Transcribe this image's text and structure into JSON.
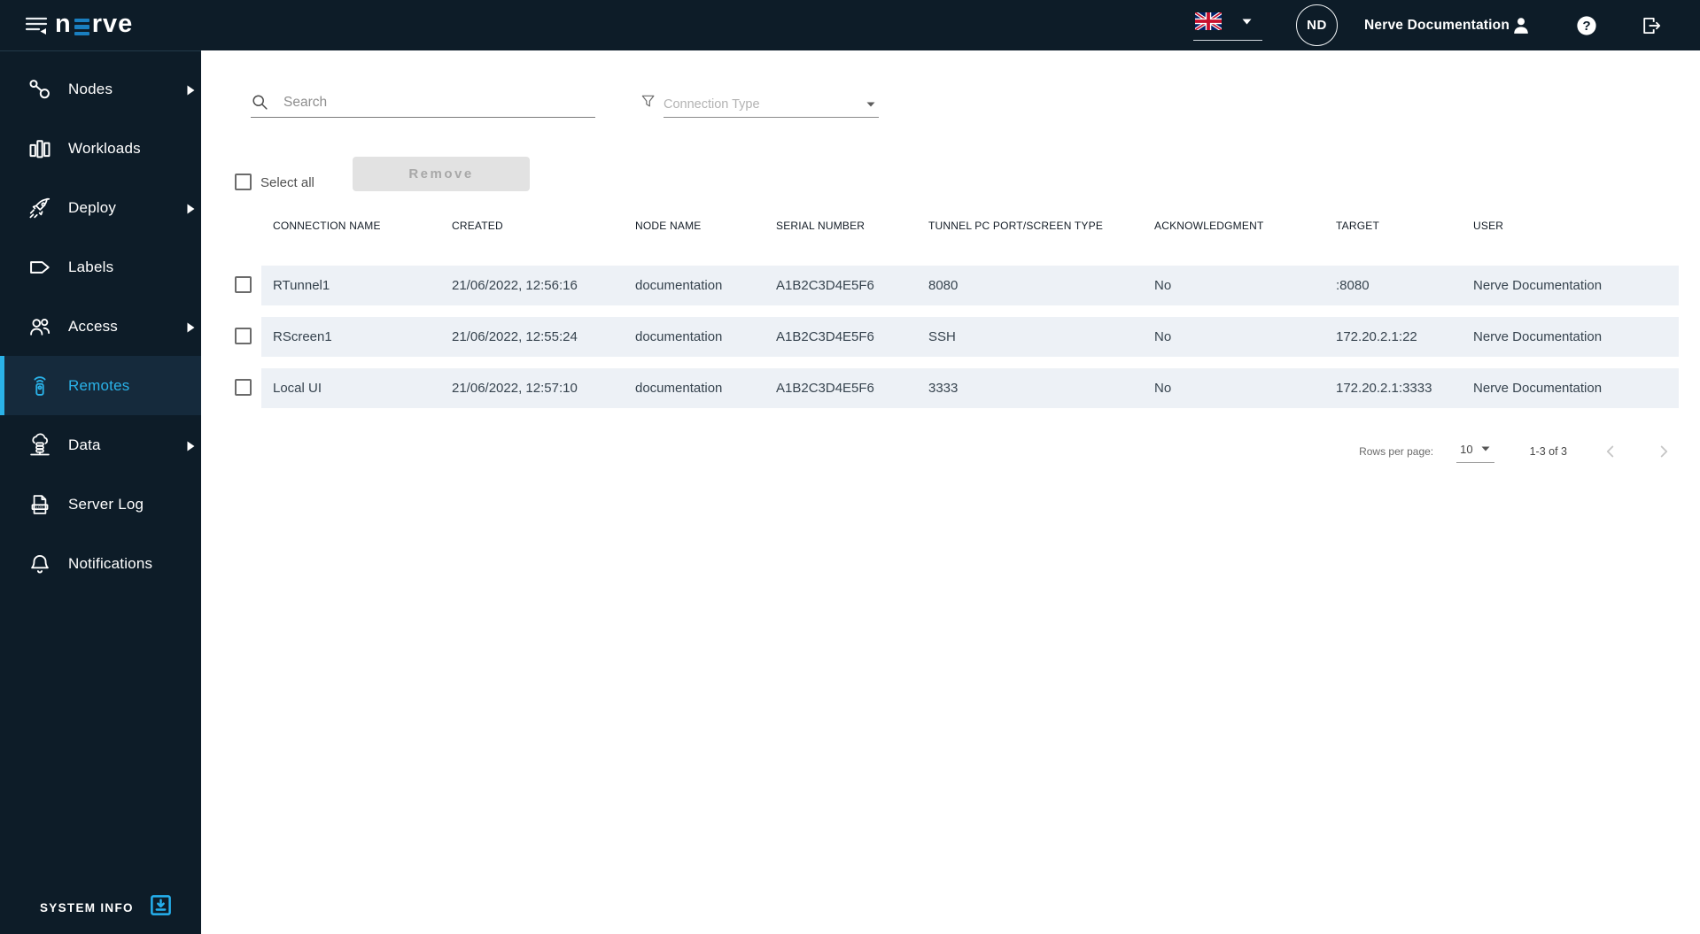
{
  "topbar": {
    "brand_prefix": "n",
    "brand_suffix": "rve",
    "language": {
      "icon": "uk-flag"
    },
    "user": {
      "initials": "ND",
      "name": "Nerve Documentation"
    }
  },
  "sidebar": {
    "items": [
      {
        "label": "Nodes",
        "icon": "nodes-icon",
        "has_submenu": true,
        "selected": false
      },
      {
        "label": "Workloads",
        "icon": "workloads-icon",
        "has_submenu": false,
        "selected": false
      },
      {
        "label": "Deploy",
        "icon": "deploy-icon",
        "has_submenu": true,
        "selected": false
      },
      {
        "label": "Labels",
        "icon": "labels-icon",
        "has_submenu": false,
        "selected": false
      },
      {
        "label": "Access",
        "icon": "access-icon",
        "has_submenu": true,
        "selected": false
      },
      {
        "label": "Remotes",
        "icon": "remotes-icon",
        "has_submenu": false,
        "selected": true
      },
      {
        "label": "Data",
        "icon": "data-icon",
        "has_submenu": true,
        "selected": false
      },
      {
        "label": "Server Log",
        "icon": "server-log-icon",
        "has_submenu": false,
        "selected": false
      },
      {
        "label": "Notifications",
        "icon": "notifications-icon",
        "has_submenu": false,
        "selected": false
      }
    ],
    "footer_label": "SYSTEM INFO"
  },
  "toolbar": {
    "search_placeholder": "Search",
    "filter_placeholder": "Connection Type",
    "select_all_label": "Select all",
    "remove_label": "Remove"
  },
  "table": {
    "columns": [
      "CONNECTION NAME",
      "CREATED",
      "NODE NAME",
      "SERIAL NUMBER",
      "TUNNEL PC PORT/SCREEN TYPE",
      "ACKNOWLEDGMENT",
      "TARGET",
      "USER"
    ],
    "rows": [
      {
        "connection_name": "RTunnel1",
        "created": "21/06/2022, 12:56:16",
        "node_name": "documentation",
        "serial_number": "A1B2C3D4E5F6",
        "tunnel_pc_port_screen_type": "8080",
        "acknowledgment": "No",
        "target": ":8080",
        "user": "Nerve Documentation"
      },
      {
        "connection_name": "RScreen1",
        "created": "21/06/2022, 12:55:24",
        "node_name": "documentation",
        "serial_number": "A1B2C3D4E5F6",
        "tunnel_pc_port_screen_type": "SSH",
        "acknowledgment": "No",
        "target": "172.20.2.1:22",
        "user": "Nerve Documentation"
      },
      {
        "connection_name": "Local UI",
        "created": "21/06/2022, 12:57:10",
        "node_name": "documentation",
        "serial_number": "A1B2C3D4E5F6",
        "tunnel_pc_port_screen_type": "3333",
        "acknowledgment": "No",
        "target": "172.20.2.1:3333",
        "user": "Nerve Documentation"
      }
    ]
  },
  "pagination": {
    "rows_per_page_label": "Rows per page:",
    "rows_per_page_value": "10",
    "range_label": "1-3 of 3"
  },
  "colors": {
    "topbar_bg": "#0d1c28",
    "accent_blue": "#2ab2e8",
    "logo_bar_blue": "#1a7fc0",
    "selected_item_bg": "#152a3c",
    "row_bg": "#edf1f6",
    "system_info_icon": "#25b1ef",
    "disabled_button_bg": "#e2e2e2"
  }
}
